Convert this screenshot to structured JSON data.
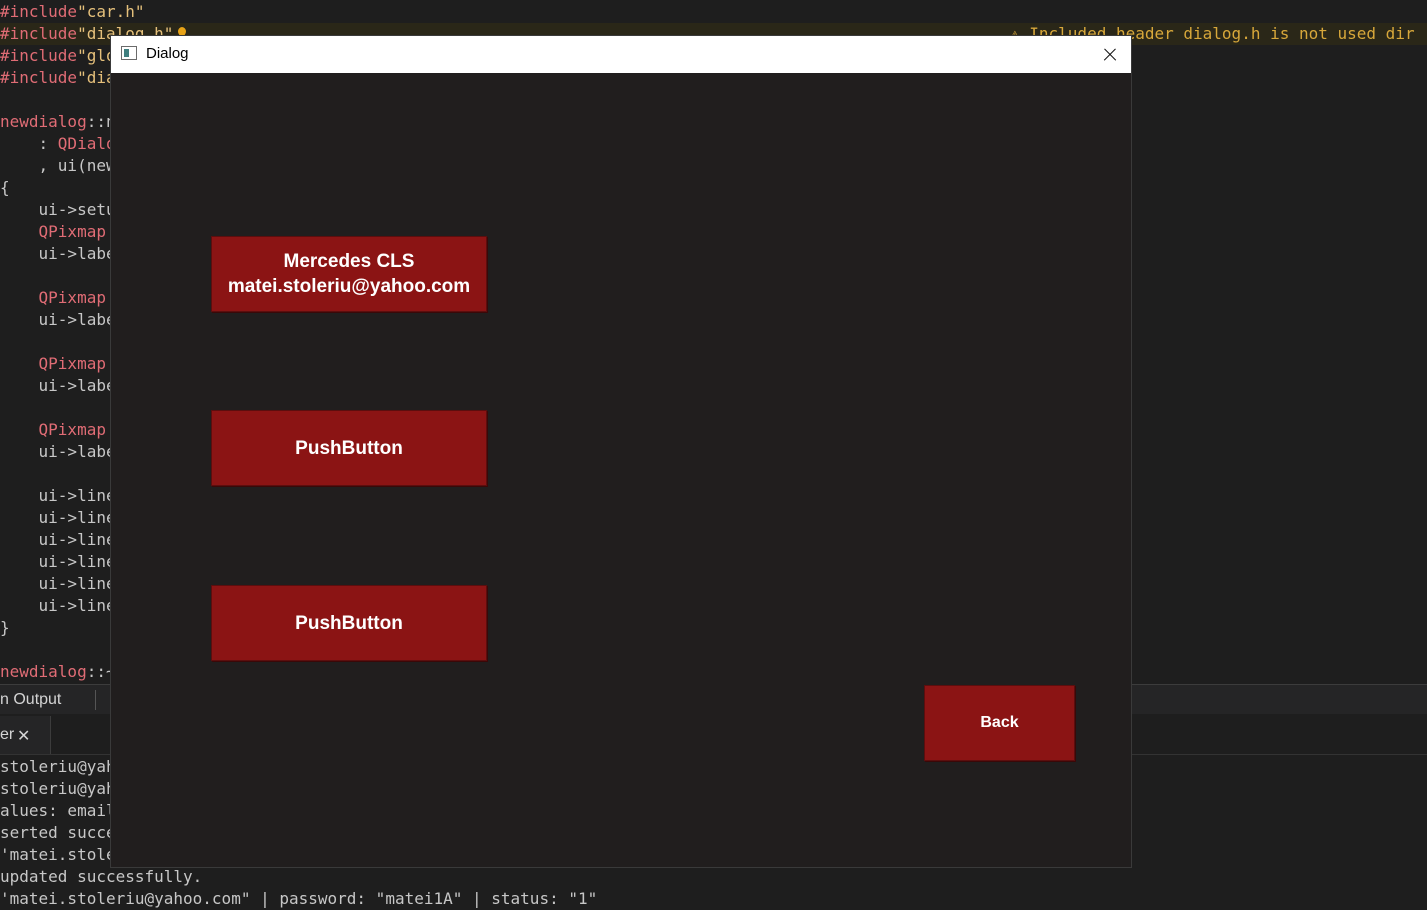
{
  "editor": {
    "lines": [
      {
        "parts": [
          {
            "t": "#include",
            "c": "c-red"
          },
          {
            "t": "\"car.h\"",
            "c": "c-yellow"
          }
        ]
      },
      {
        "parts": [
          {
            "t": "#include",
            "c": "c-red"
          },
          {
            "t": "\"dialog.h\"",
            "c": "c-yellow"
          }
        ]
      },
      {
        "parts": [
          {
            "t": "#include",
            "c": "c-red"
          },
          {
            "t": "\"glo",
            "c": "c-yellow"
          }
        ]
      },
      {
        "parts": [
          {
            "t": "#include",
            "c": "c-red"
          },
          {
            "t": "\"dia",
            "c": "c-yellow"
          }
        ]
      },
      {
        "parts": []
      },
      {
        "parts": [
          {
            "t": "newdialog",
            "c": "c-red"
          },
          {
            "t": "::n",
            "c": "c-plain"
          }
        ]
      },
      {
        "parts": [
          {
            "t": "    : ",
            "c": "c-plain"
          },
          {
            "t": "QDialo",
            "c": "c-red"
          }
        ]
      },
      {
        "parts": [
          {
            "t": "    , ui(",
            "c": "c-plain"
          },
          {
            "t": "new",
            "c": "c-plain"
          }
        ]
      },
      {
        "parts": [
          {
            "t": "{",
            "c": "c-plain"
          }
        ]
      },
      {
        "parts": [
          {
            "t": "    ui->setu",
            "c": "c-plain"
          }
        ]
      },
      {
        "parts": [
          {
            "t": "    QPixmap",
            "c": "c-red"
          }
        ]
      },
      {
        "parts": [
          {
            "t": "    ui->labe",
            "c": "c-plain"
          }
        ]
      },
      {
        "parts": []
      },
      {
        "parts": [
          {
            "t": "    QPixmap",
            "c": "c-red"
          }
        ]
      },
      {
        "parts": [
          {
            "t": "    ui->labe",
            "c": "c-plain"
          }
        ]
      },
      {
        "parts": []
      },
      {
        "parts": [
          {
            "t": "    QPixmap",
            "c": "c-red"
          }
        ]
      },
      {
        "parts": [
          {
            "t": "    ui->labe",
            "c": "c-plain"
          }
        ]
      },
      {
        "parts": []
      },
      {
        "parts": [
          {
            "t": "    QPixmap",
            "c": "c-red"
          }
        ]
      },
      {
        "parts": [
          {
            "t": "    ui->labe",
            "c": "c-plain"
          }
        ]
      },
      {
        "parts": []
      },
      {
        "parts": [
          {
            "t": "    ui->line",
            "c": "c-plain"
          }
        ]
      },
      {
        "parts": [
          {
            "t": "    ui->line",
            "c": "c-plain"
          }
        ]
      },
      {
        "parts": [
          {
            "t": "    ui->line",
            "c": "c-plain"
          }
        ]
      },
      {
        "parts": [
          {
            "t": "    ui->line",
            "c": "c-plain"
          }
        ]
      },
      {
        "parts": [
          {
            "t": "    ui->line",
            "c": "c-plain"
          }
        ]
      },
      {
        "parts": [
          {
            "t": "    ui->line",
            "c": "c-plain"
          }
        ]
      },
      {
        "parts": [
          {
            "t": "}",
            "c": "c-plain"
          }
        ]
      },
      {
        "parts": []
      },
      {
        "parts": [
          {
            "t": "newdialog",
            "c": "c-red"
          },
          {
            "t": "::~",
            "c": "c-plain"
          }
        ]
      }
    ],
    "warning": "⚠ Included header dialog.h is not used dir"
  },
  "output_pane": {
    "title": "n Output",
    "tab_label": "er",
    "tab_close": "✕",
    "lines": [
      "stoleriu@yah",
      "stoleriu@yah",
      "alues: email",
      "serted succe",
      "'matei.stole",
      "updated successfully.",
      "'matei.stoleriu@yahoo.com\" | password: \"matei1A\" | status: \"1\""
    ]
  },
  "dialog": {
    "title": "Dialog",
    "button1_line1": "Mercedes CLS",
    "button1_line2": "matei.stoleriu@yahoo.com",
    "button2_label": "PushButton",
    "button3_label": "PushButton",
    "back_label": "Back"
  },
  "colors": {
    "button_bg": "#8b1414",
    "dialog_bg": "#211e1e",
    "editor_bg": "#1e1e1e"
  }
}
